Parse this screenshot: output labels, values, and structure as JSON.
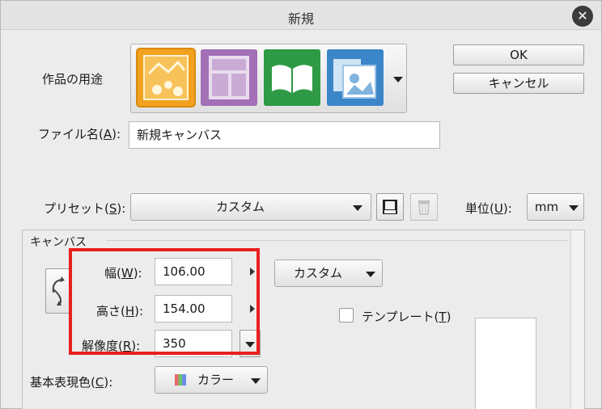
{
  "window": {
    "title": "新規",
    "close_icon": "close-icon"
  },
  "buttons": {
    "ok": "OK",
    "cancel": "キャンセル"
  },
  "usage": {
    "label": "作品の用途",
    "icons": [
      {
        "name": "illustration-icon",
        "color": "#f0a323",
        "selected": true
      },
      {
        "name": "comic-page-icon",
        "color": "#a06fb3",
        "selected": false
      },
      {
        "name": "book-icon",
        "color": "#2f9b46",
        "selected": false
      },
      {
        "name": "animation-icon",
        "color": "#3b86c8",
        "selected": false
      }
    ]
  },
  "file_name": {
    "label": "ファイル名(A):",
    "value": "新規キャンバス"
  },
  "preset": {
    "label": "プリセット(S):",
    "value": "カスタム",
    "save_icon": "save-icon",
    "delete_icon": "trash-icon"
  },
  "unit": {
    "label": "単位(U):",
    "value": "mm"
  },
  "canvas": {
    "section_label": "キャンバス",
    "width_label": "幅(W):",
    "width_value": "106.00",
    "height_label": "高さ(H):",
    "height_value": "154.00",
    "resolution_label": "解像度(R):",
    "resolution_value": "350",
    "size_preset_value": "カスタム",
    "template_label": "テンプレート(T)",
    "template_checked": false,
    "color_label": "基本表現色(C):",
    "color_value": "カラー",
    "swap_icon": "rotate-orientation-icon"
  },
  "highlight_color": "#e8201e"
}
